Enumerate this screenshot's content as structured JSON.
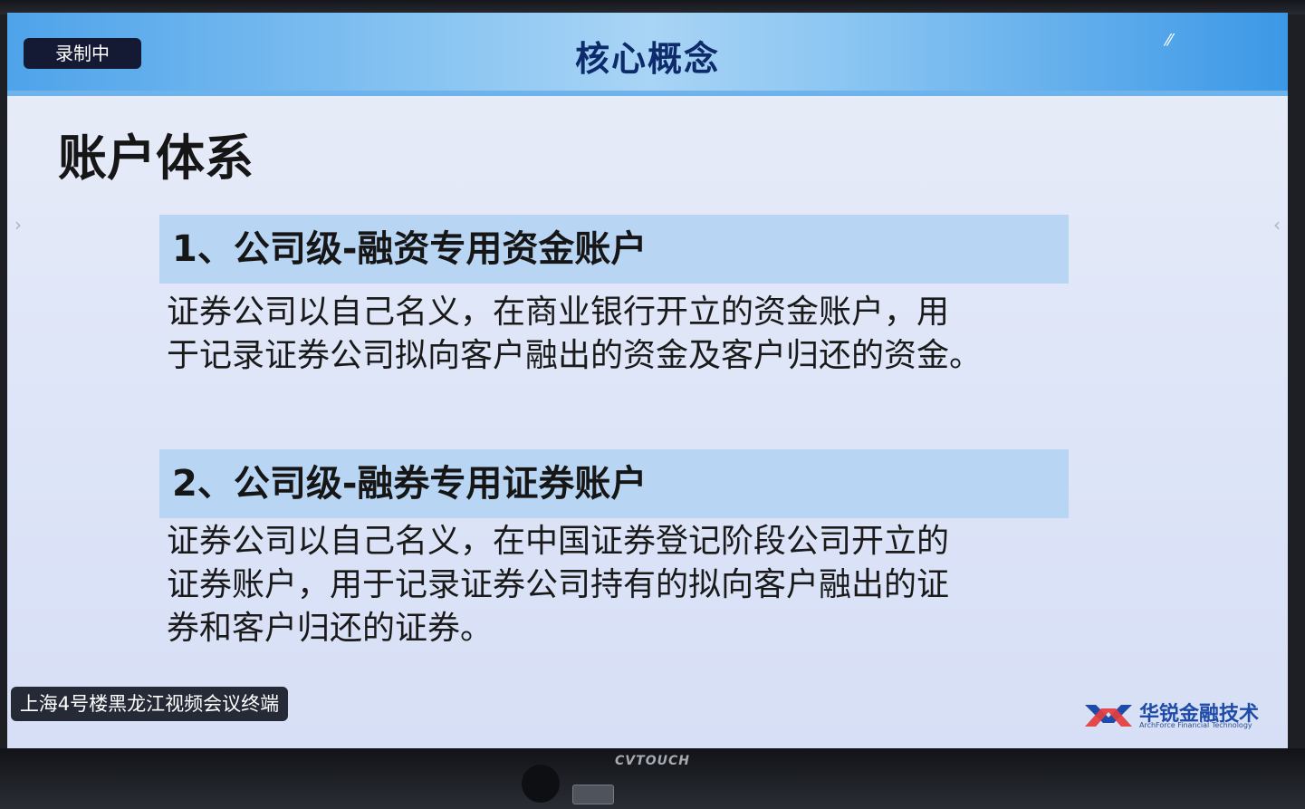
{
  "header": {
    "title": "核心概念",
    "recording_badge": "录制中"
  },
  "slide": {
    "section_title": "账户体系",
    "items": [
      {
        "heading": "1、公司级-融资专用资金账户",
        "lines": [
          "证券公司以自己名义，在商业银行开立的资金账户，用",
          "于记录证券公司拟向客户融出的资金及客户归还的资金。"
        ]
      },
      {
        "heading": "2、公司级-融券专用证券账户",
        "lines": [
          "证券公司以自己名义，在中国证券登记阶段公司开立的",
          "证券账户，用于记录证券公司持有的拟向客户融出的证",
          "券和客户归还的证券。"
        ]
      }
    ]
  },
  "footer": {
    "terminal_label": "上海4号楼黑龙江视频会议终端",
    "logo_text_cn": "华锐金融技术",
    "logo_text_en": "ArchForce Financial Technology"
  },
  "monitor": {
    "brand": "CVTOUCH"
  },
  "icons": {
    "left_arrow": "chevron-right-icon",
    "right_arrow": "chevron-left-icon",
    "logo_mark": "archforce-logo-icon"
  },
  "colors": {
    "title_text": "#0d2b6b",
    "heading_bg": "#b9d5f4",
    "logo_blue": "#1e4aa8",
    "logo_red": "#e53d3d"
  }
}
